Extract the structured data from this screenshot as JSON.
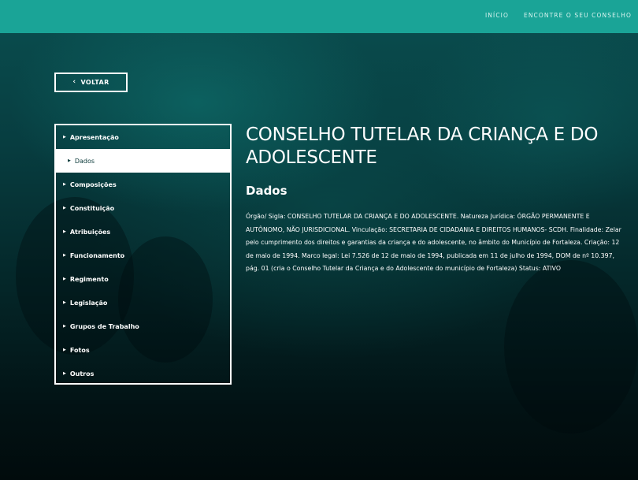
{
  "topbar": {
    "nav": [
      {
        "label": "INÍCIO"
      },
      {
        "label": "ENCONTRE O SEU CONSELHO"
      }
    ]
  },
  "back_button": {
    "label": "VOLTAR"
  },
  "menu": {
    "items": [
      {
        "label": "Apresentação",
        "active": false
      },
      {
        "label": "Dados",
        "active": true
      },
      {
        "label": "Composições",
        "active": false
      },
      {
        "label": "Constituição",
        "active": false
      },
      {
        "label": "Atribuições",
        "active": false
      },
      {
        "label": "Funcionamento",
        "active": false
      },
      {
        "label": "Regimento",
        "active": false
      },
      {
        "label": "Legislação",
        "active": false
      },
      {
        "label": "Grupos de Trabalho",
        "active": false
      },
      {
        "label": "Fotos",
        "active": false
      },
      {
        "label": "Outros",
        "active": false
      }
    ]
  },
  "content": {
    "title": "CONSELHO TUTELAR DA CRIANÇA E DO ADOLESCENTE",
    "section": "Dados",
    "body": "Órgão/ Sigla: CONSELHO TUTELAR DA CRIANÇA E DO ADOLESCENTE. Natureza Jurídica: ÓRGÃO PERMANENTE E AUTÔNOMO, NÃO JURISDICIONAL. Vinculação: SECRETARIA DE CIDADANIA E DIREITOS HUMANOS- SCDH. Finalidade: Zelar pelo cumprimento dos direitos e garantias da criança e do adolescente, no âmbito do Município de Fortaleza. Criação: 12 de maio de 1994. Marco legal: Lei 7.526 de 12 de maio de 1994, publicada em 11 de julho de 1994, DOM de nº 10.397, pág. 01 (cria o Conselho Tutelar da Criança e do Adolescente do município de Fortaleza) Status: ATIVO"
  },
  "colors": {
    "topbar": "#1aa497",
    "background": "#042628",
    "active_item_bg": "#ffffff"
  },
  "icons": {
    "back": "chevron-left-icon",
    "menu_item": "caret-right-icon"
  }
}
